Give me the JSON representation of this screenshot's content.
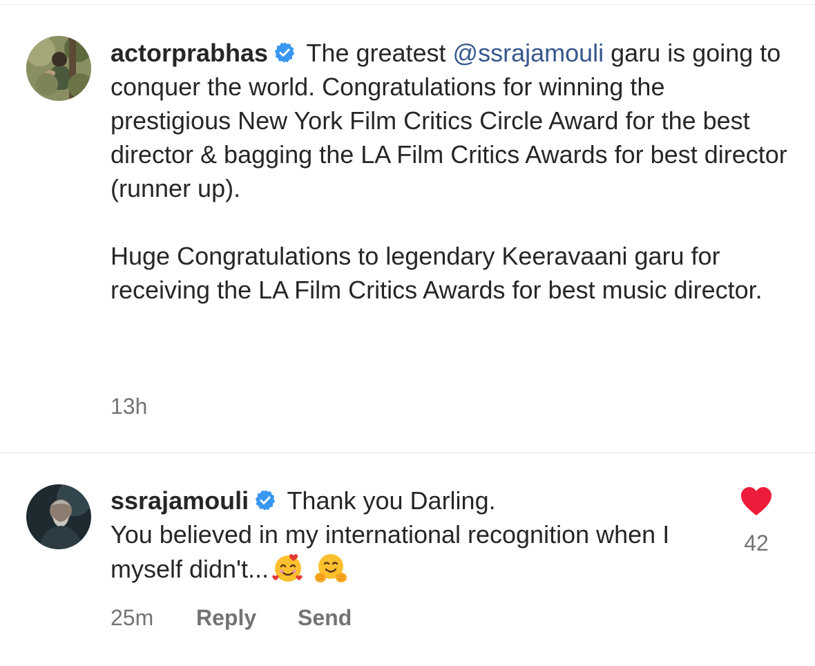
{
  "comments": [
    {
      "username": "actorprabhas",
      "verified": true,
      "text_before_mention": " The greatest ",
      "mention": "@ssrajamouli",
      "text_after_mention": " garu is going to conquer the world. Congratulations for winning the prestigious New York Film Critics Circle Award for the best director & bagging the LA Film Critics Awards for best director (runner up).\n\nHuge Congratulations to legendary Keeravaani garu for receiving the LA Film Critics Awards for best music director.",
      "time": "13h",
      "avatar_icon": "profile-photo-avatar"
    },
    {
      "username": "ssrajamouli",
      "verified": true,
      "text": " Thank you Darling.\nYou believed in my international recognition when I myself didn't...",
      "emojis": [
        "smiling-face-with-hearts-emoji",
        "hugging-face-emoji"
      ],
      "time": "25m",
      "reply_label": "Reply",
      "send_label": "Send",
      "like_count": "42",
      "liked": true,
      "avatar_icon": "profile-photo-avatar"
    }
  ],
  "colors": {
    "text": "#262626",
    "secondary": "#737373",
    "verified": "#3897f0",
    "like": "#ed1c3a",
    "mention": "#35578c"
  }
}
